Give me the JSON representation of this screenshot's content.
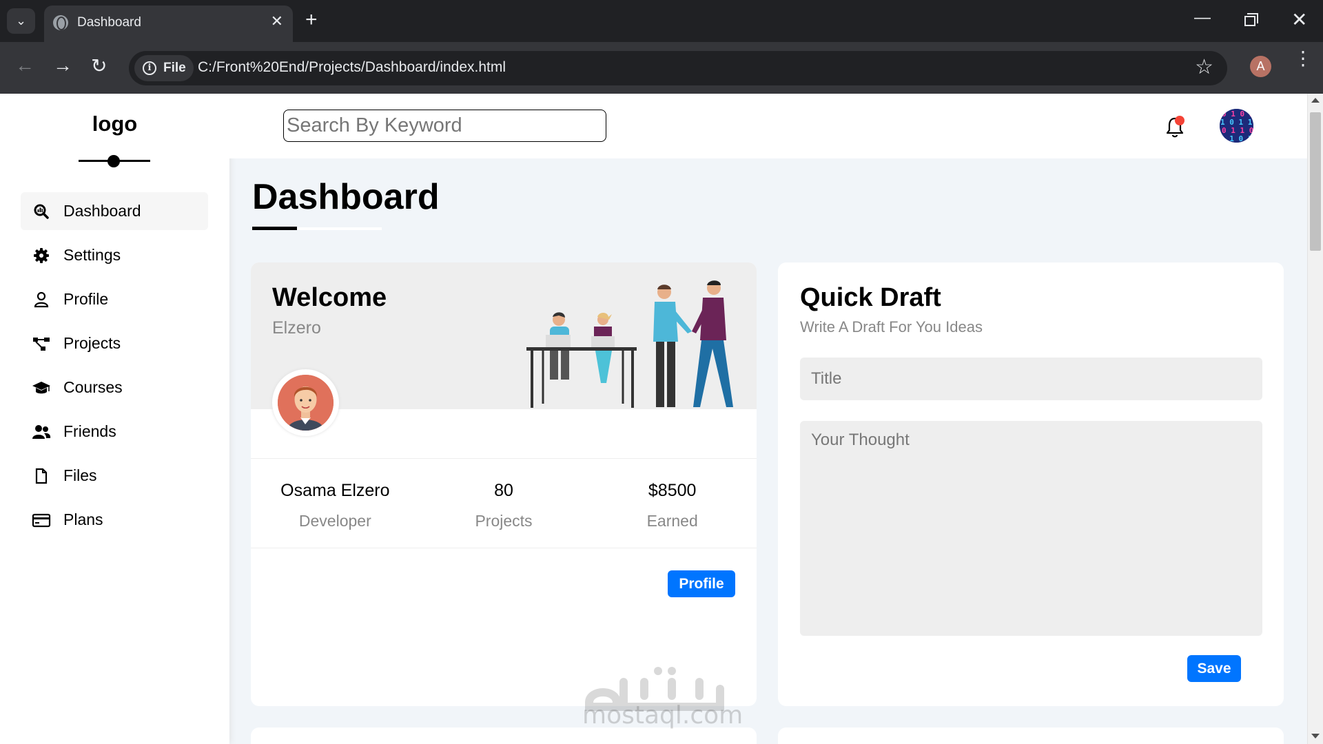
{
  "browser": {
    "tab_title": "Dashboard",
    "tab_close": "✕",
    "new_tab": "+",
    "minimize": "—",
    "close": "✕",
    "back": "←",
    "forward": "→",
    "reload": "↻",
    "file_chip": "File",
    "url": "C:/Front%20End/Projects/Dashboard/index.html",
    "bookmark": "☆",
    "profile_initial": "A",
    "menu": "⋮"
  },
  "sidebar": {
    "logo": "logo",
    "items": [
      {
        "label": "Dashboard",
        "icon": "chart-search-icon",
        "active": true
      },
      {
        "label": "Settings",
        "icon": "gear-icon",
        "active": false
      },
      {
        "label": "Profile",
        "icon": "user-icon",
        "active": false
      },
      {
        "label": "Projects",
        "icon": "diagram-icon",
        "active": false
      },
      {
        "label": "Courses",
        "icon": "graduation-cap-icon",
        "active": false
      },
      {
        "label": "Friends",
        "icon": "users-icon",
        "active": false
      },
      {
        "label": "Files",
        "icon": "file-icon",
        "active": false
      },
      {
        "label": "Plans",
        "icon": "credit-card-icon",
        "active": false
      }
    ]
  },
  "header": {
    "search_placeholder": "Search By Keyword"
  },
  "main": {
    "title": "Dashboard"
  },
  "welcome": {
    "title": "Welcome",
    "subtitle": "Elzero",
    "stats": [
      {
        "value": "Osama Elzero",
        "label": "Developer"
      },
      {
        "value": "80",
        "label": "Projects"
      },
      {
        "value": "$8500",
        "label": "Earned"
      }
    ],
    "button": "Profile"
  },
  "quick_draft": {
    "title": "Quick Draft",
    "subtitle": "Write A Draft For You Ideas",
    "title_placeholder": "Title",
    "thought_placeholder": "Your Thought",
    "button": "Save"
  },
  "watermark": {
    "text": "mostaql.com"
  },
  "colors": {
    "accent": "#0075ff",
    "page_bg": "#f1f5f9",
    "notification_dot": "#f44336"
  }
}
